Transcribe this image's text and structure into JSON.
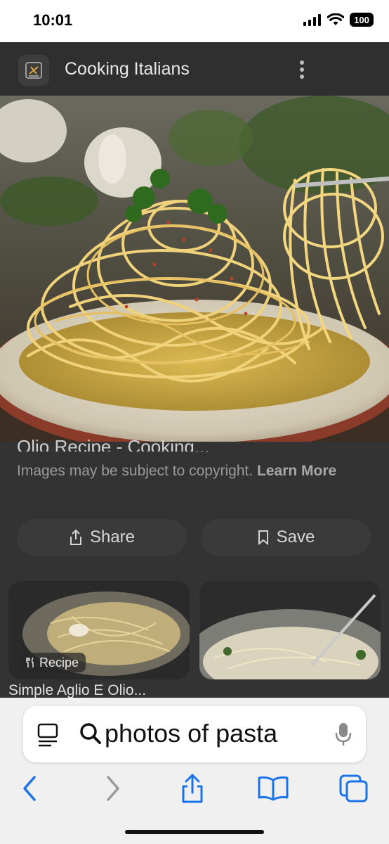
{
  "status_bar": {
    "time": "10:01",
    "battery_label": "100",
    "icons": [
      "signal-bars-icon",
      "wifi-icon",
      "battery-icon"
    ]
  },
  "site": {
    "name": "Cooking Italians",
    "logo_icon": "chef-logo-icon",
    "menu_icon": "more-vertical-icon"
  },
  "hero_image": {
    "subject": "spaghetti-aglio-olio-on-plate-with-fork"
  },
  "result": {
    "title_partial": "Olio Recipe - Cooking...",
    "copyright_text": "Images may be subject to copyright.",
    "learn_more_label": "Learn More"
  },
  "actions": {
    "share_label": "Share",
    "save_label": "Save"
  },
  "related": [
    {
      "badge": "Recipe",
      "caption": "Simple Aglio E Olio..."
    },
    {
      "badge": "",
      "caption": ""
    }
  ],
  "safari": {
    "search_text": "photos of pasta",
    "accent_color": "#1a73e8",
    "toolbar_icons": [
      "back-chevron-icon",
      "forward-chevron-icon",
      "share-icon",
      "bookmarks-icon",
      "tabs-icon"
    ]
  }
}
